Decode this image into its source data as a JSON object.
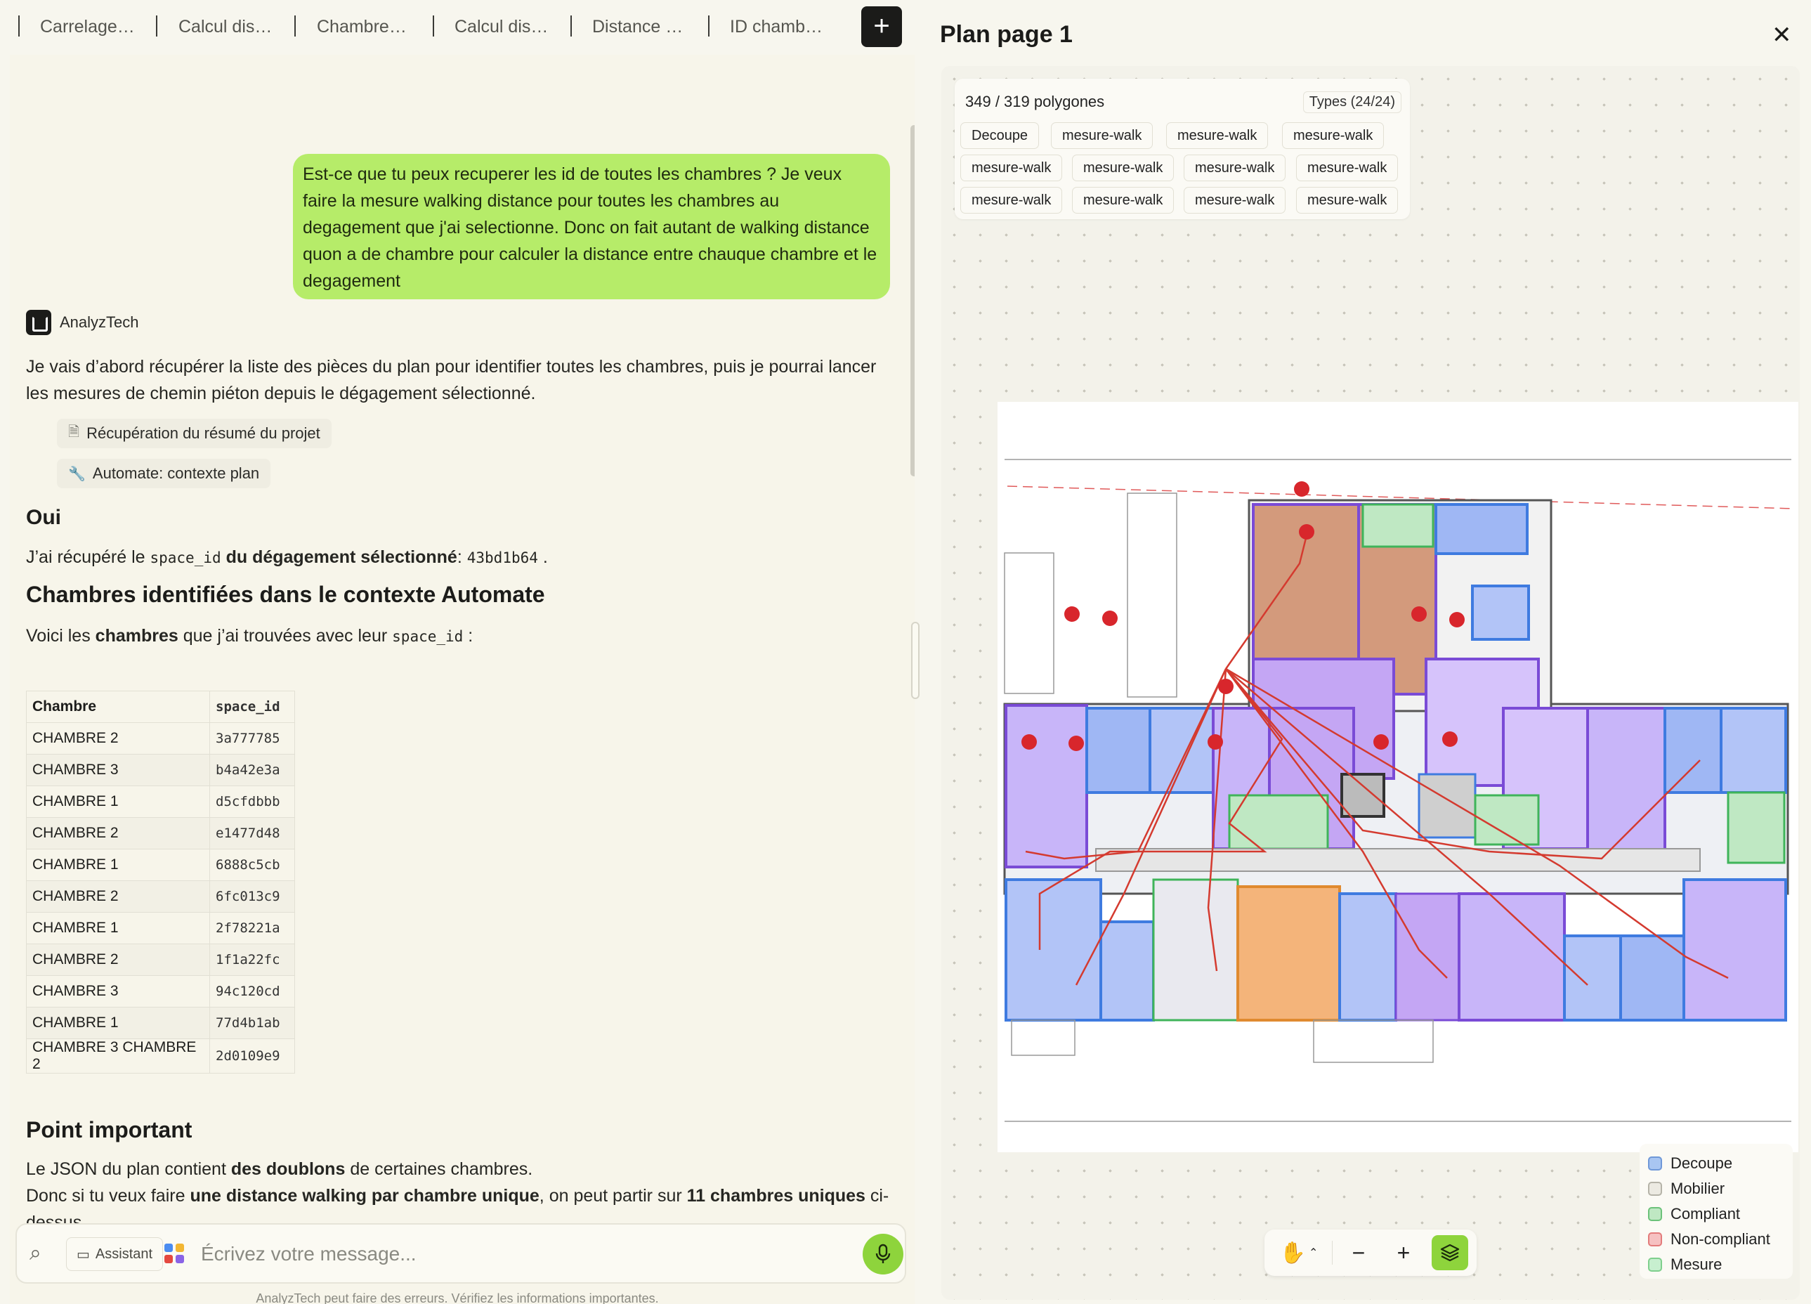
{
  "tabs": [
    "Carrelage…",
    "Calcul dis…",
    "Chambre…",
    "Calcul dis…",
    "Distance …",
    "ID chamb…"
  ],
  "new_tab_label": "+",
  "user_message": "Est-ce que tu peux recuperer les id de toutes les chambres ? Je veux faire la mesure walking distance pour toutes les chambres au degagement que j'ai selectionne. Donc on fait autant de walking distance quon a de chambre pour calculer la distance entre chauque chambre et le degagement",
  "assistant": {
    "name": "AnalyzTech",
    "intro": "Je vais d’abord récupérer la liste des pièces du plan pour identifier toutes les chambres, puis je pourrai lancer les mesures de chemin piéton depuis le dégagement sélectionné.",
    "tool_calls": [
      "Récupération du résumé du projet",
      "Automate: contexte plan"
    ],
    "heading_oui": "Oui",
    "space_line": {
      "prefix": "J’ai récupéré le",
      "code": "space_id",
      "mid": "du dégagement sélectionné",
      "colon": ":",
      "value": "43bd1b64",
      "end": "."
    },
    "heading_rooms": "Chambres identifiées dans le contexte Automate",
    "rooms_intro": {
      "prefix": "Voici les",
      "bold": "chambres",
      "mid": "que j’ai trouvées avec leur",
      "code": "space_id",
      "end": ":"
    },
    "table": {
      "headers": [
        "Chambre",
        "space_id"
      ],
      "rows": [
        [
          "CHAMBRE 2",
          "3a777785"
        ],
        [
          "CHAMBRE 3",
          "b4a42e3a"
        ],
        [
          "CHAMBRE 1",
          "d5cfdbbb"
        ],
        [
          "CHAMBRE 2",
          "e1477d48"
        ],
        [
          "CHAMBRE 1",
          "6888c5cb"
        ],
        [
          "CHAMBRE 2",
          "6fc013c9"
        ],
        [
          "CHAMBRE 1",
          "2f78221a"
        ],
        [
          "CHAMBRE 2",
          "1f1a22fc"
        ],
        [
          "CHAMBRE 3",
          "94c120cd"
        ],
        [
          "CHAMBRE 1",
          "77d4b1ab"
        ],
        [
          "CHAMBRE 3 CHAMBRE 2",
          "2d0109e9"
        ]
      ]
    },
    "heading_important": "Point important",
    "important_1": {
      "prefix": "Le JSON du plan contient",
      "bold": "des doublons",
      "end": "de certaines chambres."
    },
    "important_2": {
      "prefix": "Donc si tu veux faire",
      "bold": "une distance walking par chambre unique",
      "mid": ", on peut partir sur",
      "bold2": "11 chambres uniques",
      "end": "ci-dessus."
    }
  },
  "composer": {
    "assistant_label": "Assistant",
    "placeholder": "Écrivez votre message...",
    "disclaimer": "AnalyzTech peut faire des erreurs. Vérifiez les informations importantes."
  },
  "plan": {
    "title": "Plan page 1",
    "polygon_count": "349 / 319 polygones",
    "types_label": "Types (24/24)",
    "tags": [
      "Decoupe",
      "mesure-walk",
      "mesure-walk",
      "mesure-walk",
      "mesure-walk",
      "mesure-walk",
      "mesure-walk",
      "mesure-walk",
      "mesure-walk",
      "mesure-walk",
      "mesure-walk",
      "mesure-walk"
    ],
    "legend": [
      {
        "label": "Decoupe",
        "color": "#a9c6f2",
        "border": "#6f98d8"
      },
      {
        "label": "Mobilier",
        "color": "#eceae2",
        "border": "#b5b3a8"
      },
      {
        "label": "Compliant",
        "color": "#bfe8c3",
        "border": "#6cc27a"
      },
      {
        "label": "Non-compliant",
        "color": "#f6c1c1",
        "border": "#e37b7b"
      },
      {
        "label": "Mesure",
        "color": "#c7efcf",
        "border": "#7fcf8d"
      }
    ]
  },
  "colors": {
    "user_bubble": "#b6ec69",
    "accent_green": "#8ed43c",
    "room_purple": "#c4a6f4",
    "room_blue": "#9fb7f4",
    "room_orange": "#f4b47a",
    "room_brown": "#d69c7e",
    "walk_line": "#d43a2f",
    "marker": "#d8262c"
  }
}
